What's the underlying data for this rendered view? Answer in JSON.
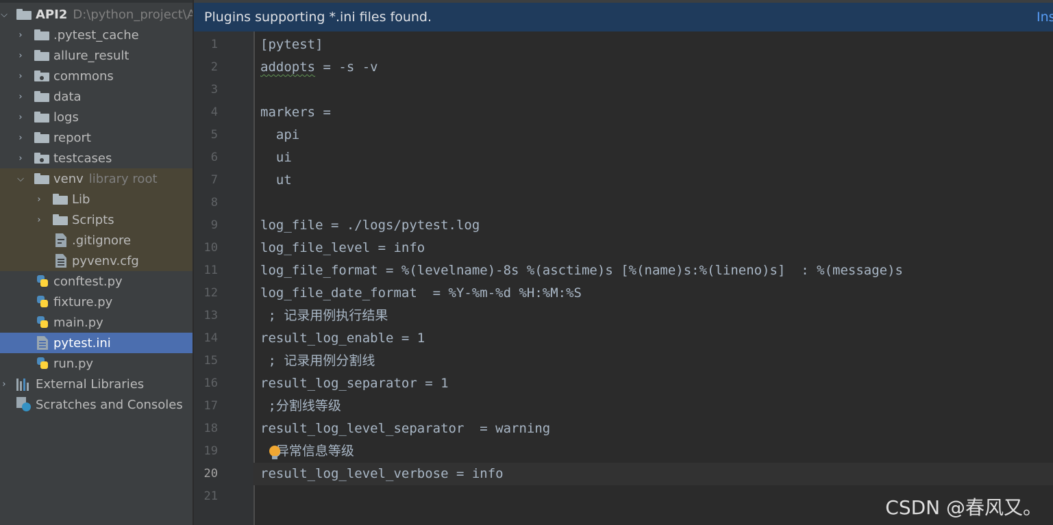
{
  "project_tree": {
    "root": {
      "name": "API2",
      "path": "D:\\python_project\\A"
    },
    "items": [
      {
        "label": ".pytest_cache"
      },
      {
        "label": "allure_result"
      },
      {
        "label": "commons"
      },
      {
        "label": "data"
      },
      {
        "label": "logs"
      },
      {
        "label": "report"
      },
      {
        "label": "testcases"
      },
      {
        "label": "venv",
        "hint": "library root"
      },
      {
        "label": "Lib"
      },
      {
        "label": "Scripts"
      },
      {
        "label": ".gitignore"
      },
      {
        "label": "pyvenv.cfg"
      },
      {
        "label": "conftest.py"
      },
      {
        "label": "fixture.py"
      },
      {
        "label": "main.py"
      },
      {
        "label": "pytest.ini"
      },
      {
        "label": "run.py"
      },
      {
        "label": "External Libraries"
      },
      {
        "label": "Scratches and Consoles"
      }
    ]
  },
  "banner": {
    "message": "Plugins supporting *.ini files found.",
    "action": "Ins"
  },
  "editor": {
    "current_line": 20,
    "lines": [
      {
        "n": "1",
        "text": "[pytest]"
      },
      {
        "n": "2",
        "pre": "",
        "warn": "addopts",
        "post": " = -s -v"
      },
      {
        "n": "3",
        "text": ""
      },
      {
        "n": "4",
        "text": "markers ="
      },
      {
        "n": "5",
        "text": "  api"
      },
      {
        "n": "6",
        "text": "  ui"
      },
      {
        "n": "7",
        "text": "  ut"
      },
      {
        "n": "8",
        "text": ""
      },
      {
        "n": "9",
        "text": "log_file = ./logs/pytest.log"
      },
      {
        "n": "10",
        "text": "log_file_level = info"
      },
      {
        "n": "11",
        "text": "log_file_format = %(levelname)-8s %(asctime)s [%(name)s:%(lineno)s]  : %(message)s"
      },
      {
        "n": "12",
        "text": "log_file_date_format  = %Y-%m-%d %H:%M:%S"
      },
      {
        "n": "13",
        "text": " ; 记录用例执行结果"
      },
      {
        "n": "14",
        "text": "result_log_enable = 1"
      },
      {
        "n": "15",
        "text": " ; 记录用例分割线"
      },
      {
        "n": "16",
        "text": "result_log_separator = 1"
      },
      {
        "n": "17",
        "text": " ;分割线等级"
      },
      {
        "n": "18",
        "text": "result_log_level_separator  = warning"
      },
      {
        "n": "19",
        "text": "  异常信息等级"
      },
      {
        "n": "20",
        "text": "result_log_level_verbose = info"
      },
      {
        "n": "21",
        "text": ""
      }
    ]
  },
  "watermark": "CSDN @春风又。"
}
